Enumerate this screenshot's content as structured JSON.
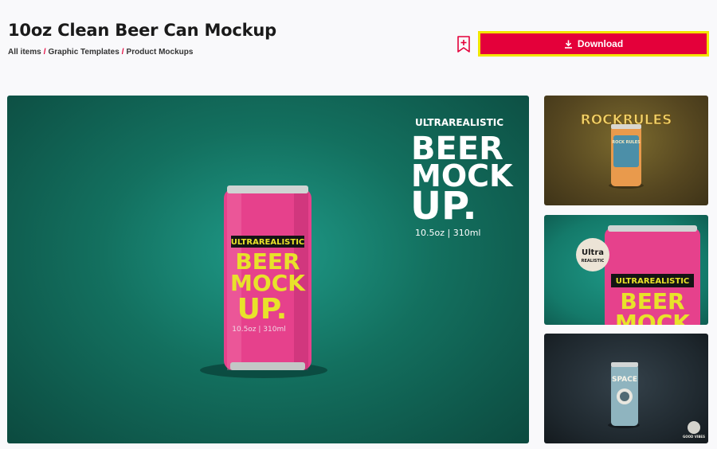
{
  "header": {
    "title": "10oz Clean Beer Can Mockup",
    "breadcrumb": [
      "All items",
      "Graphic Templates",
      "Product Mockups"
    ],
    "breadcrumb_sep": "/"
  },
  "actions": {
    "bookmark_icon": "bookmark-add-icon",
    "download_label": "Download",
    "download_icon": "download-icon",
    "download_color": "#e4003a",
    "download_outline": "#f2e600"
  },
  "preview": {
    "headline_top": "ULTRAREALISTIC",
    "headline_lines": [
      "BEER",
      "MOCK",
      "UP."
    ],
    "size_text": "10.5oz | 310ml",
    "can_label_top": "ULTRAREALISTIC",
    "can_lines": [
      "BEER",
      "MOCK",
      "UP."
    ],
    "can_size": "10.5oz | 310ml"
  },
  "thumbnails": [
    {
      "caption": "ROCKRULES",
      "can_text": "ROCK RULES"
    },
    {
      "badge": "Ultra",
      "badge_sub": "REALISTIC",
      "can_label": "ULTRAREALISTIC",
      "can_lines": [
        "BEER",
        "MOCK"
      ]
    },
    {
      "can_text": "SPACE",
      "logo": "GOOD VIBES"
    }
  ]
}
